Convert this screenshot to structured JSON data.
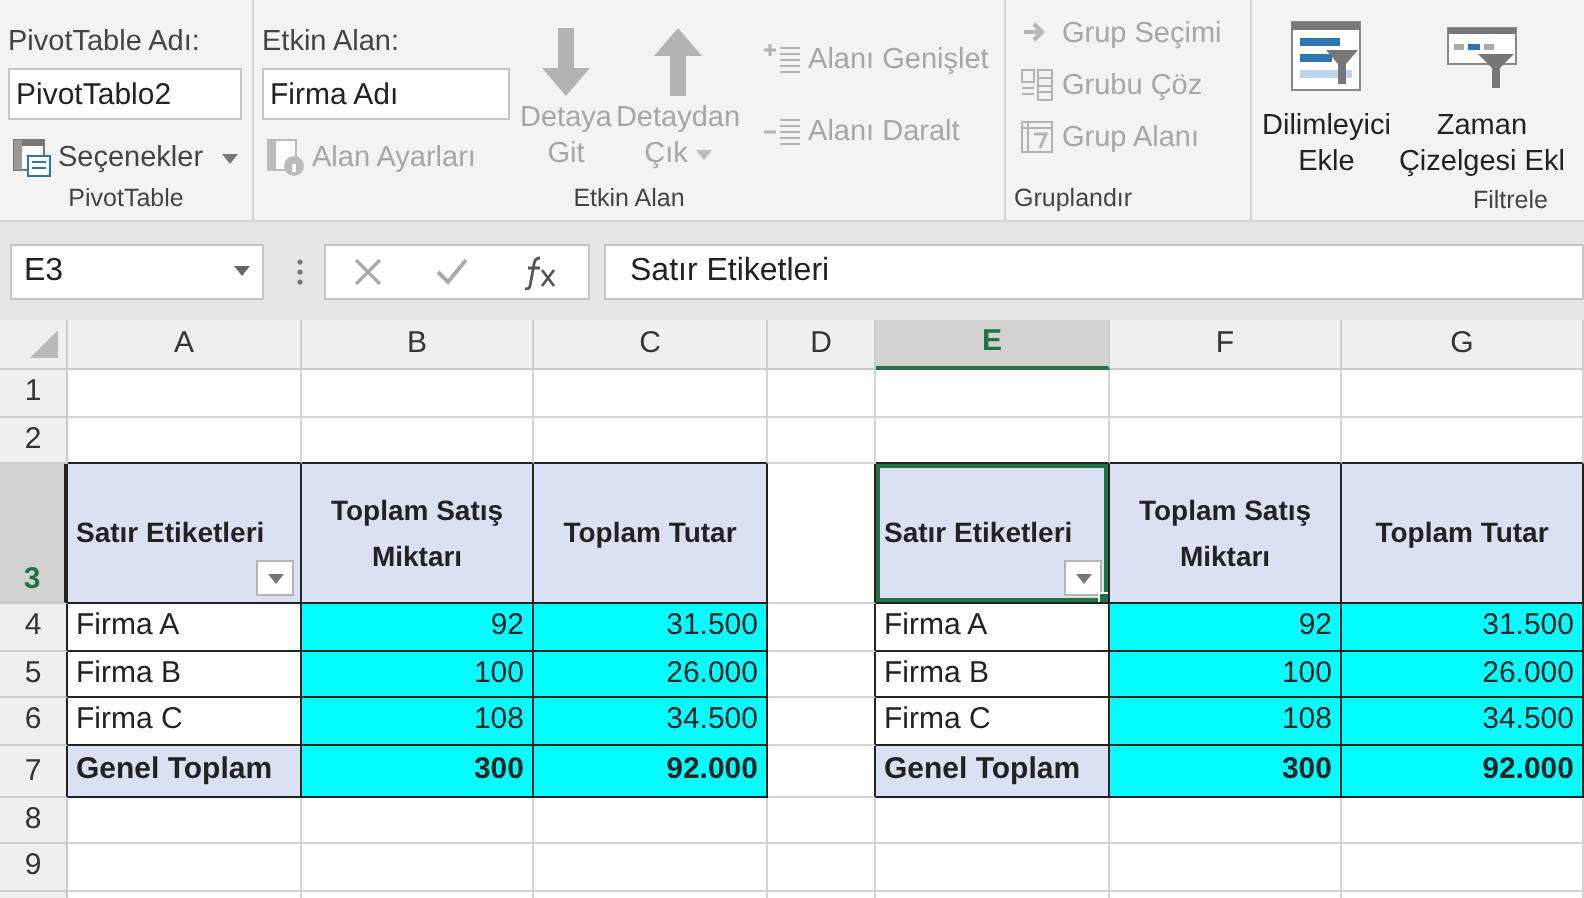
{
  "ribbon": {
    "pivottable": {
      "name_label": "PivotTable Adı:",
      "name_value": "PivotTablo2",
      "options_button": {
        "label": "Seçenekler",
        "dropdown": true
      },
      "group_label": "PivotTable"
    },
    "active_field": {
      "label": "Etkin Alan:",
      "value": "Firma Adı",
      "field_settings": {
        "label": "Alan Ayarları",
        "disabled": true
      },
      "drill_buttons": [
        {
          "lines": [
            "Detaya",
            "Git"
          ],
          "kind": "down",
          "disabled": true,
          "dropdown": false
        },
        {
          "lines": [
            "Detaydan",
            "Çık"
          ],
          "kind": "up",
          "disabled": true,
          "dropdown": true
        }
      ],
      "expand_buttons": [
        {
          "label": "Alanı Genişlet",
          "kind": "expand",
          "disabled": true
        },
        {
          "label": "Alanı Daralt",
          "kind": "collapse",
          "disabled": true
        }
      ],
      "group_label": "Etkin Alan"
    },
    "grouping": {
      "items": [
        {
          "label": "Grup Seçimi",
          "kind": "arrow",
          "disabled": true
        },
        {
          "label": "Grubu Çöz",
          "kind": "ungroup",
          "disabled": true
        },
        {
          "label": "Grup Alanı",
          "kind": "field",
          "disabled": true
        }
      ],
      "group_label": "Gruplandır"
    },
    "filter": {
      "buttons": [
        {
          "lines": [
            "Dilimleyici",
            "Ekle"
          ],
          "kind": "slicer"
        },
        {
          "lines": [
            "Zaman",
            "Çizelgesi Ekl"
          ],
          "kind": "timeline"
        }
      ],
      "group_label": "Filtrele"
    }
  },
  "formula_bar": {
    "name_box": "E3",
    "formula": "Satır Etiketleri"
  },
  "sheet": {
    "columns": [
      {
        "label": "A",
        "selected": false
      },
      {
        "label": "B",
        "selected": false
      },
      {
        "label": "C",
        "selected": false
      },
      {
        "label": "D",
        "selected": false
      },
      {
        "label": "E",
        "selected": true
      },
      {
        "label": "F",
        "selected": false
      },
      {
        "label": "G",
        "selected": false
      }
    ],
    "rows": [
      {
        "label": "1",
        "selected": false,
        "kind": "blank"
      },
      {
        "label": "2",
        "selected": false,
        "kind": "blank"
      },
      {
        "label": "3",
        "selected": true,
        "kind": "header",
        "tables": [
          {
            "cells": [
              "Satır Etiketleri",
              "Toplam Satış Miktarı",
              "Toplam Tutar"
            ],
            "filter_button": true,
            "active": false
          },
          {
            "cells": [
              "Satır Etiketleri",
              "Toplam Satış Miktarı",
              "Toplam Tutar"
            ],
            "filter_button": true,
            "active": true
          }
        ]
      },
      {
        "label": "4",
        "selected": false,
        "kind": "item",
        "tables": [
          {
            "cells": [
              "Firma A",
              "92",
              "31.500"
            ]
          },
          {
            "cells": [
              "Firma A",
              "92",
              "31.500"
            ]
          }
        ]
      },
      {
        "label": "5",
        "selected": false,
        "kind": "item",
        "tables": [
          {
            "cells": [
              "Firma B",
              "100",
              "26.000"
            ]
          },
          {
            "cells": [
              "Firma B",
              "100",
              "26.000"
            ]
          }
        ]
      },
      {
        "label": "6",
        "selected": false,
        "kind": "item",
        "tables": [
          {
            "cells": [
              "Firma C",
              "108",
              "34.500"
            ]
          },
          {
            "cells": [
              "Firma C",
              "108",
              "34.500"
            ]
          }
        ]
      },
      {
        "label": "7",
        "selected": false,
        "kind": "total",
        "tables": [
          {
            "cells": [
              "Genel Toplam",
              "300",
              "92.000"
            ]
          },
          {
            "cells": [
              "Genel Toplam",
              "300",
              "92.000"
            ]
          }
        ]
      },
      {
        "label": "8",
        "selected": false,
        "kind": "blank"
      },
      {
        "label": "9",
        "selected": false,
        "kind": "blank"
      }
    ]
  }
}
